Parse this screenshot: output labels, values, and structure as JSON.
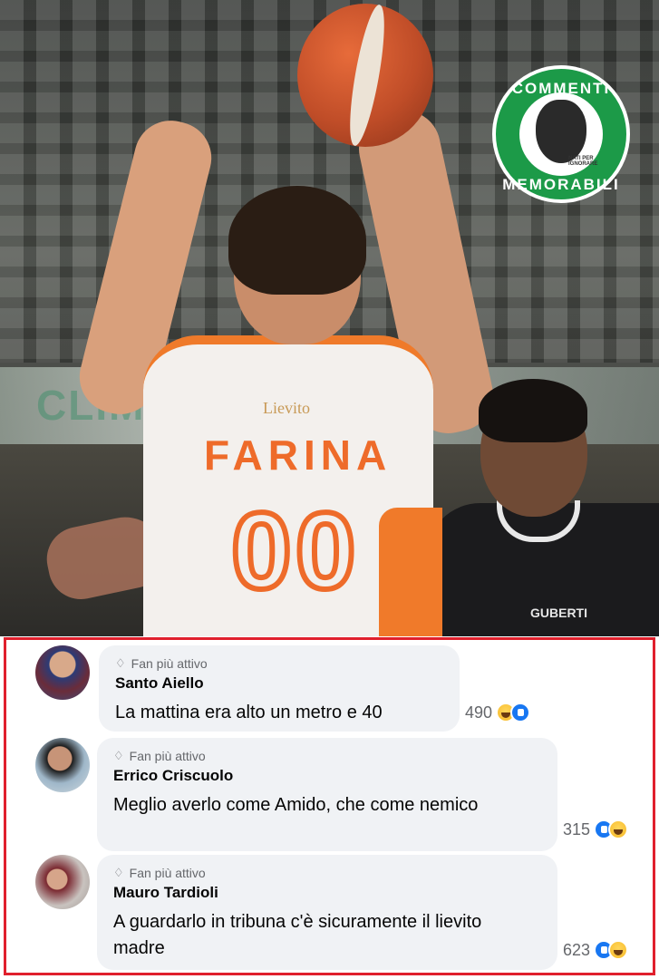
{
  "photo": {
    "jersey_sponsor": "Lievito",
    "jersey_name": "FARINA",
    "jersey_number": "00",
    "opponent_sponsor": "GUBERTI",
    "logo": {
      "top_text": "COMMENTI",
      "bottom_text": "MEMORABILI",
      "small_text": "NATI PER IGNORARE",
      "color": "#1c9a48"
    }
  },
  "comments": [
    {
      "badge": "Fan più attivo",
      "author": "Santo Aiello",
      "text": "La mattina era alto un metro e 40",
      "reaction_count": "490",
      "reactions": [
        "haha-icon",
        "like-icon"
      ]
    },
    {
      "badge": "Fan più attivo",
      "author": "Errico Criscuolo",
      "text": "Meglio averlo come Amido, che come nemico",
      "reaction_count": "315",
      "reactions": [
        "like-icon",
        "haha-icon"
      ]
    },
    {
      "badge": "Fan più attivo",
      "author": "Mauro Tardioli",
      "text": "A guardarlo in tribuna c'è sicuramente il lievito madre",
      "reaction_count": "623",
      "reactions": [
        "like-icon",
        "haha-icon"
      ]
    }
  ],
  "colors": {
    "highlight_border": "#e0202d",
    "bubble": "#f0f2f5",
    "like": "#1877f2",
    "haha": "#f7b928",
    "jersey_orange": "#ee6b2a"
  }
}
